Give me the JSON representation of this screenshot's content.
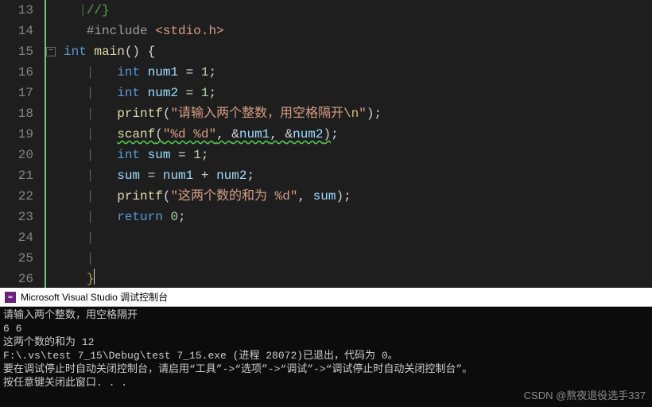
{
  "editor": {
    "first_line_no": 13,
    "lines": {
      "l13": {
        "comment": "//}"
      },
      "l14": {
        "hash": "#include ",
        "inc": "<stdio.h>"
      },
      "l15": {
        "kw1": "int",
        "fn": "main",
        "rest": "() {"
      },
      "l16": {
        "kw": "int",
        "var": "num1",
        "rest": " = ",
        "num": "1",
        "semi": ";"
      },
      "l17": {
        "kw": "int",
        "var": "num2",
        "rest": " = ",
        "num": "1",
        "semi": ";"
      },
      "l18": {
        "fn": "printf",
        "lp": "(",
        "str1": "\"请输入两个整数，用空格隔开",
        "esc": "\\n",
        "str2": "\"",
        "rp": ")",
        "semi": ";"
      },
      "l19": {
        "fn": "scanf",
        "lp": "(",
        "str": "\"%d %d\"",
        "comma1": ", ",
        "amp1": "&",
        "v1": "num1",
        "comma2": ", ",
        "amp2": "&",
        "v2": "num2",
        "rp": ")",
        "semi": ";"
      },
      "l20": {
        "kw": "int",
        "var": "sum",
        "rest": " = ",
        "num": "1",
        "semi": ";"
      },
      "l21": {
        "v1": "sum",
        "eq": " = ",
        "v2": "num1",
        "plus": " + ",
        "v3": "num2",
        "semi": ";"
      },
      "l22": {
        "fn": "printf",
        "lp": "(",
        "str": "\"这两个数的和为 %d\"",
        "comma": ", ",
        "v": "sum",
        "rp": ")",
        "semi": ";"
      },
      "l23": {
        "kw": "return",
        "sp": " ",
        "num": "0",
        "semi": ";"
      },
      "l26": {
        "br": "}"
      }
    }
  },
  "console": {
    "title": "Microsoft Visual Studio 调试控制台",
    "lines": [
      "请输入两个整数，用空格隔开",
      "6 6",
      "这两个数的和为 12",
      "F:\\.vs\\test 7_15\\Debug\\test 7_15.exe (进程 28072)已退出，代码为 0。",
      "要在调试停止时自动关闭控制台，请启用“工具”->“选项”->“调试”->“调试停止时自动关闭控制台”。",
      "按任意键关闭此窗口. . ."
    ],
    "watermark": "CSDN @熬夜退役选手337"
  }
}
